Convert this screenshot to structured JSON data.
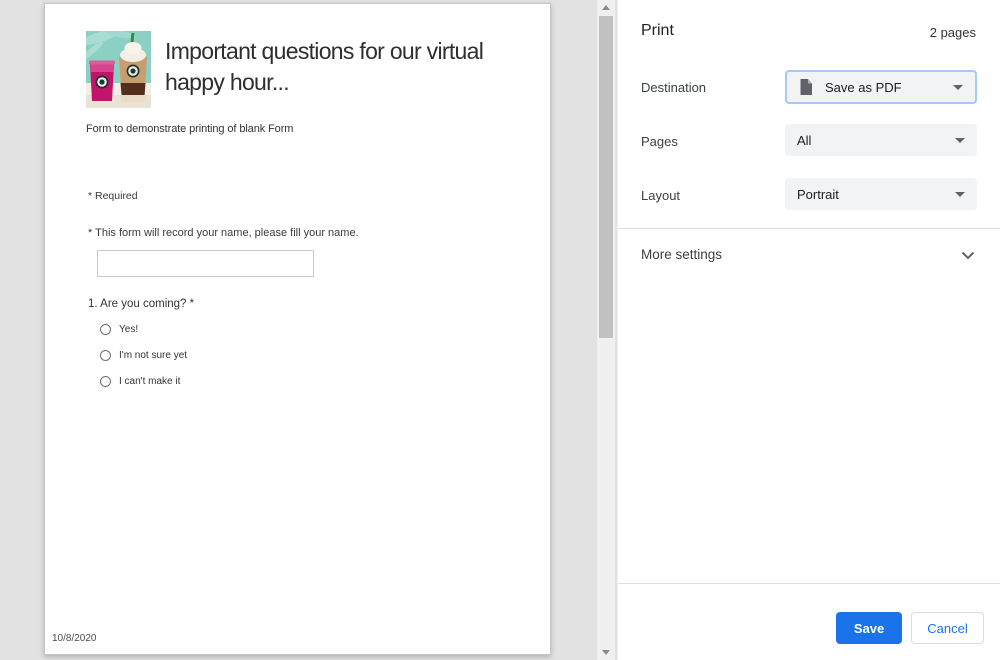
{
  "preview": {
    "page": {
      "header_image": "starbucks-drinks-photo",
      "title_line1": "Important questions for our virtual",
      "title_line2": "happy hour...",
      "subtitle": "Form to demonstrate printing of blank Form",
      "required_note": "* Required",
      "name_prompt": "* This form will record your name, please fill your name.",
      "question": {
        "label": "1. Are you coming? *",
        "options": [
          "Yes!",
          "I'm not sure yet",
          "I can't make it"
        ]
      },
      "footer_date": "10/8/2020"
    }
  },
  "panel": {
    "title": "Print",
    "page_count": "2 pages",
    "destination": {
      "label": "Destination",
      "value": "Save as PDF",
      "icon": "document-icon"
    },
    "pages": {
      "label": "Pages",
      "value": "All"
    },
    "layout": {
      "label": "Layout",
      "value": "Portrait"
    },
    "more_settings_label": "More settings",
    "buttons": {
      "save": "Save",
      "cancel": "Cancel"
    }
  },
  "colors": {
    "accent_blue": "#1a73e8",
    "focus_border": "#a8c7fa",
    "dropdown_bg": "#f1f3f4",
    "preview_bg": "#e2e2e2",
    "page_bg": "#ffffff"
  }
}
